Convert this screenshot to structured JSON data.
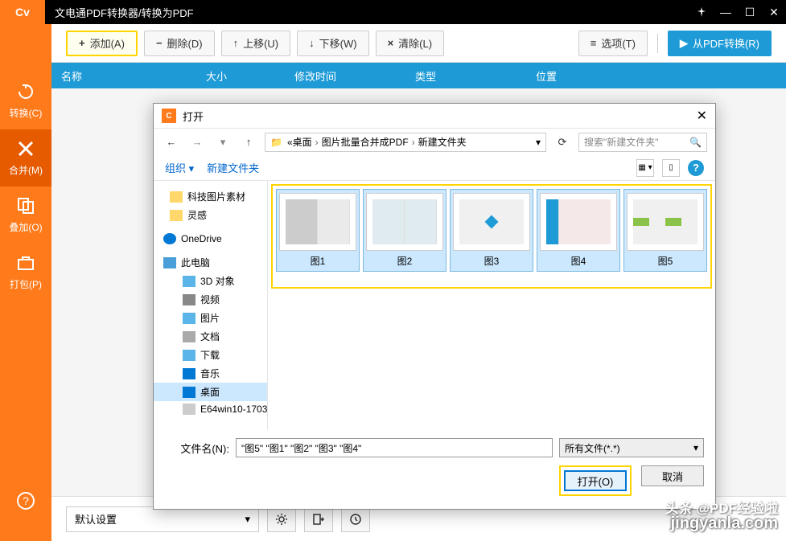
{
  "app": {
    "logo_text": "Cv",
    "title": "文电通PDF转换器/转换为PDF"
  },
  "window_controls": {
    "pin": "📌",
    "min": "—",
    "max": "☐",
    "close": "✕"
  },
  "sidebar": {
    "items": [
      {
        "label": "转换(C)",
        "icon": "convert"
      },
      {
        "label": "合并(M)",
        "icon": "merge"
      },
      {
        "label": "叠加(O)",
        "icon": "overlay"
      },
      {
        "label": "打包(P)",
        "icon": "package"
      }
    ],
    "help": "?"
  },
  "toolbar": {
    "add": "添加(A)",
    "remove": "删除(D)",
    "up": "上移(U)",
    "down": "下移(W)",
    "clear": "清除(L)",
    "options": "选项(T)",
    "convert": "从PDF转换(R)"
  },
  "list_header": {
    "name": "名称",
    "size": "大小",
    "time": "修改时间",
    "type": "类型",
    "location": "位置"
  },
  "dialog": {
    "title": "打开",
    "breadcrumb": {
      "icon": "📁",
      "parts": [
        "桌面",
        "图片批量合并成PDF",
        "新建文件夹"
      ]
    },
    "search_placeholder": "搜索\"新建文件夹\"",
    "organize": "组织",
    "new_folder": "新建文件夹",
    "tree": [
      {
        "label": "科技图片素材",
        "type": "folder"
      },
      {
        "label": "灵感",
        "type": "folder"
      },
      {
        "label": "OneDrive",
        "type": "onedrive"
      },
      {
        "label": "此电脑",
        "type": "pc"
      },
      {
        "label": "3D 对象",
        "type": "sub"
      },
      {
        "label": "视频",
        "type": "sub"
      },
      {
        "label": "图片",
        "type": "sub"
      },
      {
        "label": "文档",
        "type": "sub"
      },
      {
        "label": "下载",
        "type": "sub"
      },
      {
        "label": "音乐",
        "type": "sub"
      },
      {
        "label": "桌面",
        "type": "sub",
        "sel": true
      },
      {
        "label": "E64win10-1703",
        "type": "sub"
      }
    ],
    "files": [
      {
        "name": "图1",
        "sel": true
      },
      {
        "name": "图2",
        "sel": true
      },
      {
        "name": "图3",
        "sel": true
      },
      {
        "name": "图4",
        "sel": true
      },
      {
        "name": "图5",
        "sel": true
      }
    ],
    "filename_label": "文件名(N):",
    "filename_value": "\"图5\" \"图1\" \"图2\" \"图3\" \"图4\"",
    "filter": "所有文件(*.*)",
    "open_btn": "打开(O)",
    "cancel_btn": "取消"
  },
  "bottom": {
    "preset": "默认设置",
    "gear": "✱",
    "export": "�इ",
    "history": "↺"
  },
  "watermark": {
    "line1": "头条 @PDF经验啦",
    "line2": "jingyanla.com"
  }
}
